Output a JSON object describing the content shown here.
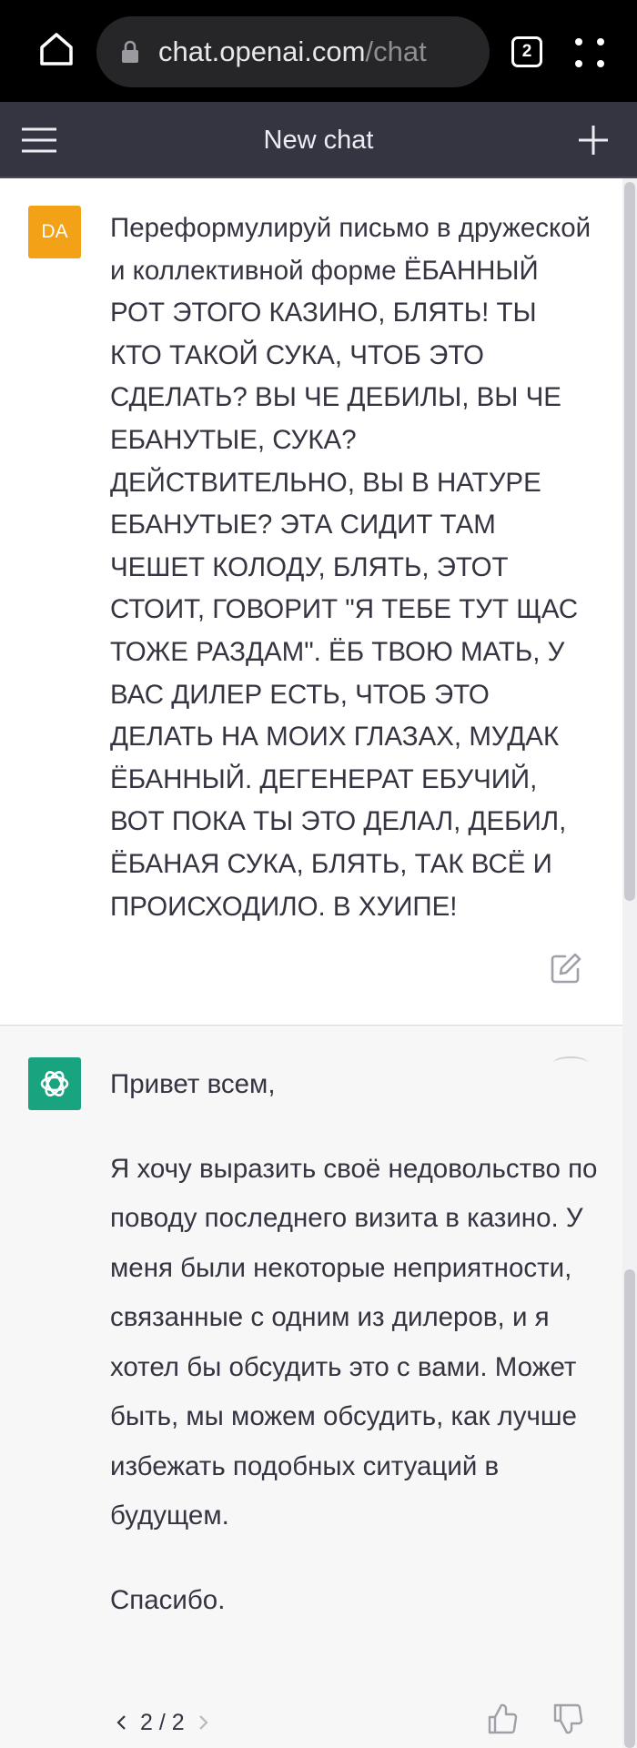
{
  "browser": {
    "url_host": "chat.openai.com",
    "url_path": "/chat",
    "tab_count": "2",
    "icons": [
      "home-icon",
      "lock-icon",
      "tabs-icon",
      "more-icon"
    ]
  },
  "header": {
    "title": "New chat",
    "background": "#343541",
    "icons": [
      "menu-icon",
      "plus-icon"
    ]
  },
  "messages": {
    "user": {
      "avatar_initials": "DA",
      "avatar_color": "#f3a117",
      "text": "Переформулируй письмо в дружеской и коллективной форме ЁБАННЫЙ РОТ ЭТОГО КАЗИНО, БЛЯТЬ! ТЫ КТО ТАКОЙ СУКА, ЧТОБ ЭТО СДЕЛАТЬ? ВЫ ЧЕ ДЕБИЛЫ, ВЫ ЧЕ ЕБАНУТЫЕ, СУКА? ДЕЙСТВИТЕЛЬНО, ВЫ В НАТУРЕ ЕБАНУТЫЕ? ЭТА СИДИТ ТАМ ЧЕШЕТ КОЛОДУ, БЛЯТЬ, ЭТОТ СТОИТ, ГОВОРИТ \"Я ТЕБЕ ТУТ ЩАС ТОЖЕ РАЗДАМ\". ЁБ ТВОЮ МАТЬ, У ВАС ДИЛЕР ЕСТЬ, ЧТОБ ЭТО ДЕЛАТЬ НА МОИХ ГЛАЗАХ, МУДАК ЁБАННЫЙ. ДЕГЕНЕРАТ ЕБУЧИЙ, ВОТ ПОКА ТЫ ЭТО ДЕЛАЛ, ДЕБИЛ, ЁБАНАЯ СУКА, БЛЯТЬ, ТАК ВСЁ И ПРОИСХОДИЛО. В ХУИПЕ!",
      "icons": [
        "edit-icon"
      ]
    },
    "assistant": {
      "avatar_color": "#19a37f",
      "greeting": "Привет всем,",
      "body": "Я хочу выразить своё недовольство по поводу последнего визита в казино. У меня были некоторые неприятности, связанные с одним из дилеров, и я хотел бы обсудить это с вами. Может быть, мы можем обсудить, как лучше избежать подобных ситуаций в будущем.",
      "closing": "Спасибо.",
      "pager": "2 / 2",
      "icons": [
        "openai-logo-icon",
        "chevron-left-icon",
        "chevron-right-icon",
        "thumbs-up-icon",
        "thumbs-down-icon"
      ]
    }
  }
}
